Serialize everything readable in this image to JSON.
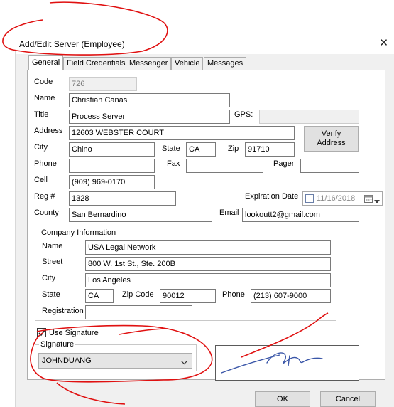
{
  "window": {
    "title": "Add/Edit Server (Employee)",
    "close_glyph": "✕"
  },
  "tabs": [
    {
      "label": "General",
      "active": true
    },
    {
      "label": "Field Credentials",
      "active": false
    },
    {
      "label": "Messenger",
      "active": false
    },
    {
      "label": "Vehicle",
      "active": false
    },
    {
      "label": "Messages",
      "active": false
    }
  ],
  "general": {
    "code_label": "Code",
    "code_value": "726",
    "name_label": "Name",
    "name_value": "Christian Canas",
    "title_label": "Title",
    "title_value": "Process Server",
    "gps_label": "GPS:",
    "gps_value": "",
    "address_label": "Address",
    "address_value": "12603 WEBSTER COURT",
    "verify_label": "Verify Address",
    "city_label": "City",
    "city_value": "Chino",
    "state_label": "State",
    "state_value": "CA",
    "zip_label": "Zip",
    "zip_value": "91710",
    "phone_label": "Phone",
    "phone_value": "",
    "fax_label": "Fax",
    "fax_value": "",
    "pager_label": "Pager",
    "pager_value": "",
    "cell_label": "Cell",
    "cell_value": "(909) 969-0170",
    "reg_label": "Reg #",
    "reg_value": "1328",
    "expiration_label": "Expiration Date",
    "expiration_value": "11/16/2018",
    "expiration_checked": false,
    "county_label": "County",
    "county_value": "San Bernardino",
    "email_label": "Email",
    "email_value": "lookoutt2@gmail.com"
  },
  "company": {
    "group_title": "Company Information",
    "name_label": "Name",
    "name_value": "USA Legal Network",
    "street_label": "Street",
    "street_value": "800 W. 1st St., Ste. 200B",
    "city_label": "City",
    "city_value": "Los Angeles",
    "state_label": "State",
    "state_value": "CA",
    "zip_label": "Zip Code",
    "zip_value": "90012",
    "phone_label": "Phone",
    "phone_value": "(213) 607-9000",
    "registration_label": "Registration",
    "registration_value": ""
  },
  "signature": {
    "use_label": "Use Signature",
    "use_checked": true,
    "group_title": "Signature",
    "selected": "JOHNDUANG"
  },
  "buttons": {
    "ok": "OK",
    "cancel": "Cancel"
  },
  "icons": {
    "calendar": "calendar-icon",
    "chevron": "chevron-down-icon",
    "check": "checkmark-icon",
    "close": "close-icon"
  },
  "colors": {
    "annotation": "#e01010",
    "signature_ink": "#3a56a8"
  }
}
